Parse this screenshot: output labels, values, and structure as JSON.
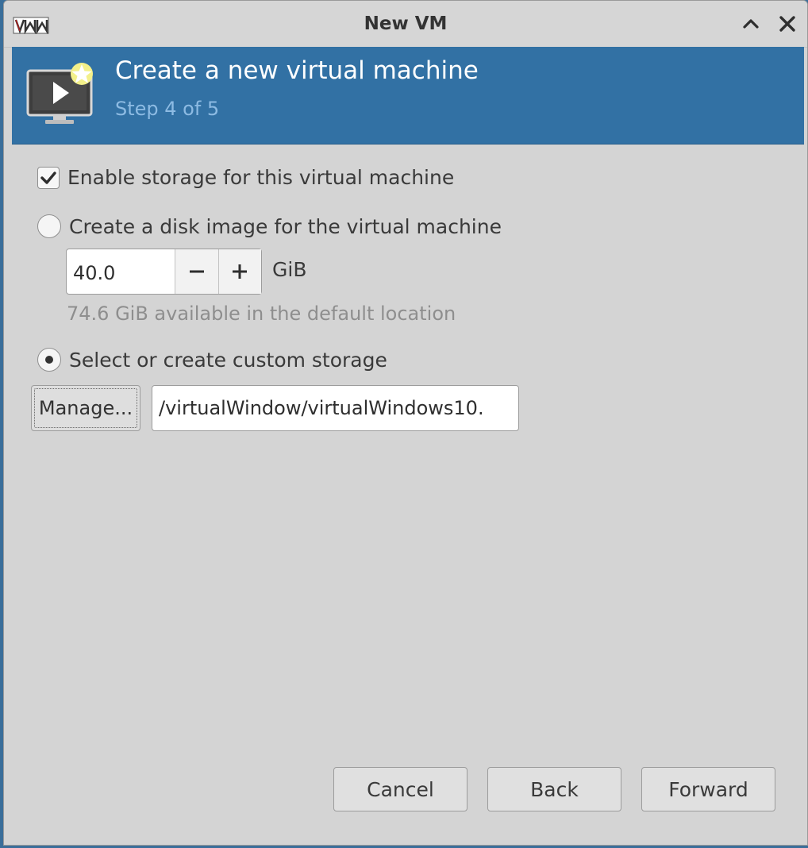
{
  "window": {
    "title": "New VM"
  },
  "banner": {
    "title": "Create a new virtual machine",
    "step": "Step 4 of 5"
  },
  "storage": {
    "enable_label": "Enable storage for this virtual machine",
    "enable_checked": true,
    "disk_image_label": "Create a disk image for the virtual machine",
    "disk_image_selected": false,
    "size_value": "40.0",
    "size_unit": "GiB",
    "available_hint": "74.6 GiB available in the default location",
    "custom_label": "Select or create custom storage",
    "custom_selected": true,
    "manage_label": "Manage...",
    "custom_path": "/virtualWindow/virtualWindows10."
  },
  "footer": {
    "cancel_label": "Cancel",
    "back_label": "Back",
    "forward_label": "Forward"
  },
  "icons": {
    "app": "vm-logo-icon",
    "maximize": "chevron-up-icon",
    "close": "close-icon",
    "banner": "monitor-play-star-icon"
  },
  "colors": {
    "banner_bg": "#3271a4",
    "banner_sub": "#8dbbe3",
    "window_bg": "#d4d4d4"
  }
}
